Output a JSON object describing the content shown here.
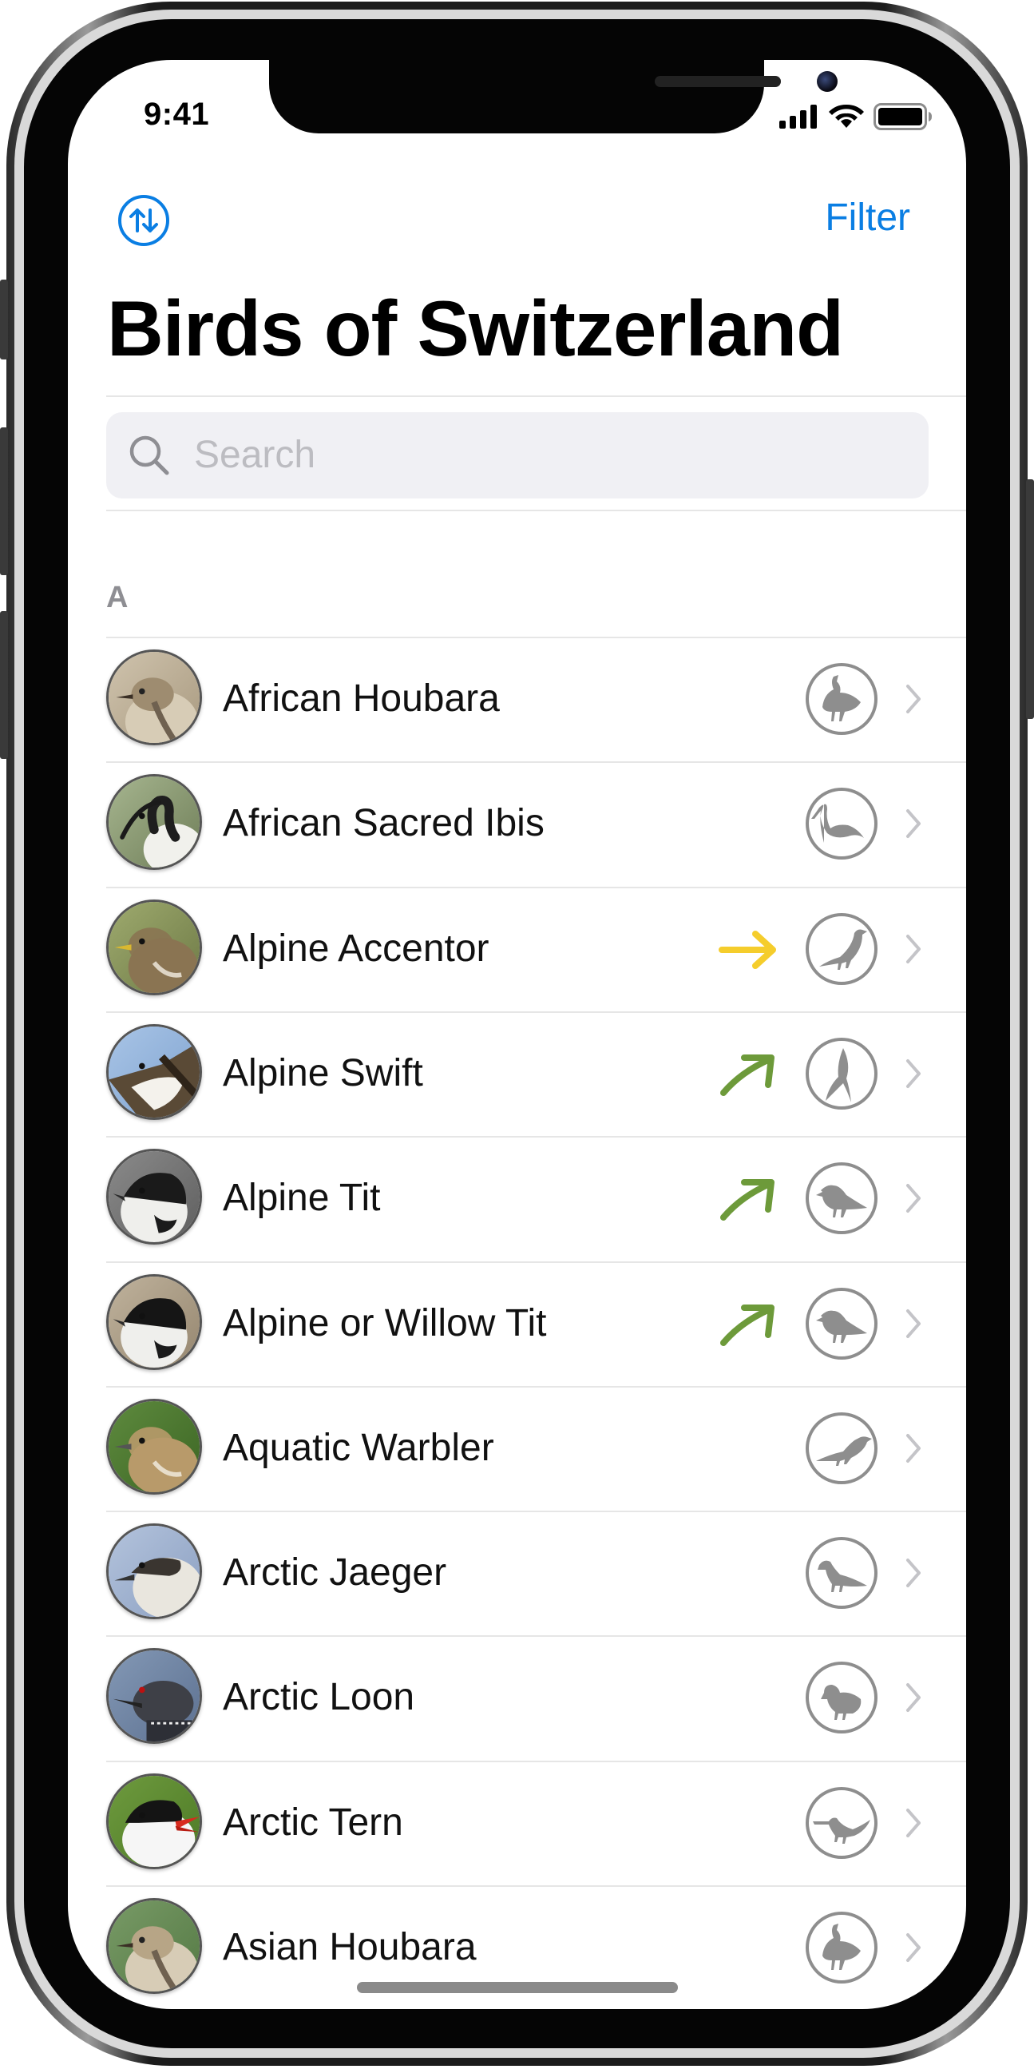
{
  "status_bar": {
    "time": "9:41"
  },
  "nav": {
    "sort_icon": "sort-arrows-icon",
    "filter_label": "Filter"
  },
  "title": "Birds of Switzerland",
  "search": {
    "placeholder": "Search",
    "icon": "search-icon"
  },
  "section": "A",
  "accent_color": "#0a7ee3",
  "trend_colors": {
    "right": "#f5cd2c",
    "up_right": "#6d9a3a"
  },
  "birds": [
    {
      "name": "African Houbara",
      "trend": "",
      "silhouette": "bustard"
    },
    {
      "name": "African Sacred Ibis",
      "trend": "",
      "silhouette": "ibis"
    },
    {
      "name": "Alpine Accentor",
      "trend": "right",
      "silhouette": "songbird"
    },
    {
      "name": "Alpine Swift",
      "trend": "up-right",
      "silhouette": "swift"
    },
    {
      "name": "Alpine Tit",
      "trend": "up-right",
      "silhouette": "tit"
    },
    {
      "name": "Alpine or Willow Tit",
      "trend": "up-right",
      "silhouette": "tit"
    },
    {
      "name": "Aquatic Warbler",
      "trend": "",
      "silhouette": "warbler"
    },
    {
      "name": "Arctic Jaeger",
      "trend": "",
      "silhouette": "gull"
    },
    {
      "name": "Arctic Loon",
      "trend": "",
      "silhouette": "pigeon"
    },
    {
      "name": "Arctic Tern",
      "trend": "",
      "silhouette": "tern"
    },
    {
      "name": "Asian Houbara",
      "trend": "",
      "silhouette": "bustard"
    }
  ]
}
